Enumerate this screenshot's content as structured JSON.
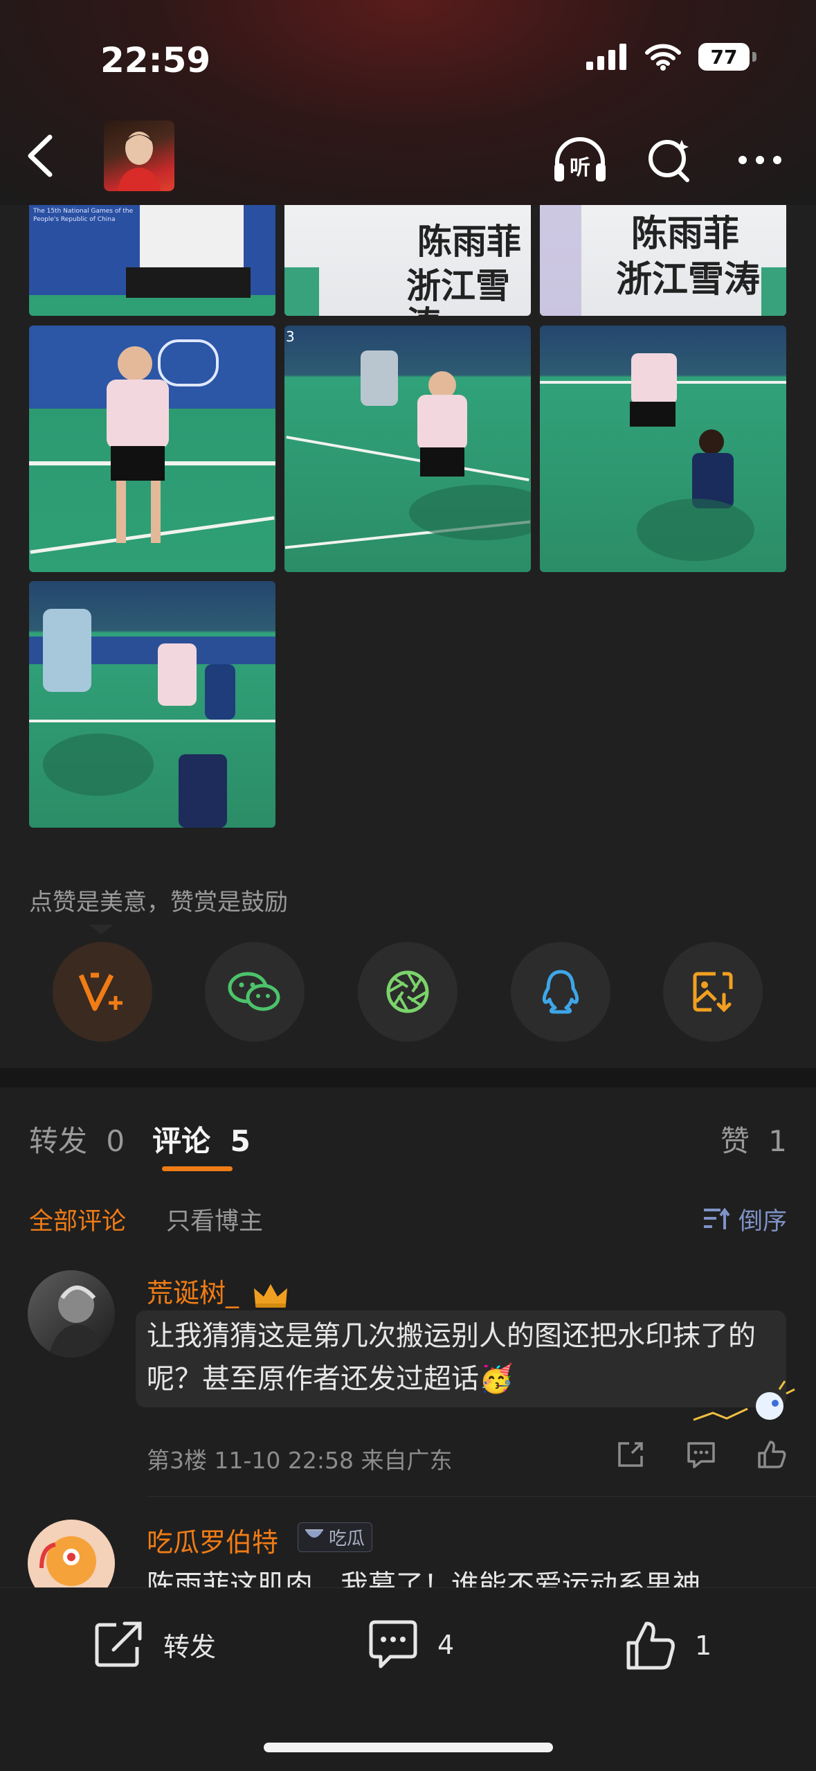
{
  "status_bar": {
    "time": "22:59",
    "battery": "77"
  },
  "header": {
    "listen_icon_label": "听",
    "icons": [
      "back-icon",
      "headphones-listen-icon",
      "search-icon",
      "more-icon"
    ]
  },
  "photos": {
    "shirt_text_line1": "陈雨菲",
    "shirt_text_line2": "浙江雪涛",
    "banner_text": "The 15th National Games of the People's Republic of China",
    "court_number": "3"
  },
  "praise_tip": "点赞是美意，赞赏是鼓励",
  "share_buttons": [
    "reward-v-icon",
    "wechat-icon",
    "moments-icon",
    "qq-icon",
    "save-image-icon"
  ],
  "tabs": {
    "repost_label": "转发",
    "repost_count": "0",
    "comment_label": "评论",
    "comment_count": "5",
    "like_label": "赞",
    "like_count": "1"
  },
  "filters": {
    "all": "全部评论",
    "blogger_only": "只看博主",
    "sort": "倒序"
  },
  "comments": [
    {
      "name": "荒诞树_",
      "text": "让我猜猜这是第几次搬运别人的图还把水印抹了的呢？甚至原作者还发过超话🥳",
      "meta": "第3楼 11-10 22:58 来自广东"
    },
    {
      "name": "吃瓜罗伯特",
      "badge": "吃瓜",
      "text": "陈雨菲这肌肉，我慕了！谁能不爱运动系男神"
    }
  ],
  "bottom_bar": {
    "repost_label": "转发",
    "comment_count": "4",
    "like_count": "1"
  },
  "colors": {
    "accent": "#f07c16",
    "background": "#1f1f1f"
  }
}
